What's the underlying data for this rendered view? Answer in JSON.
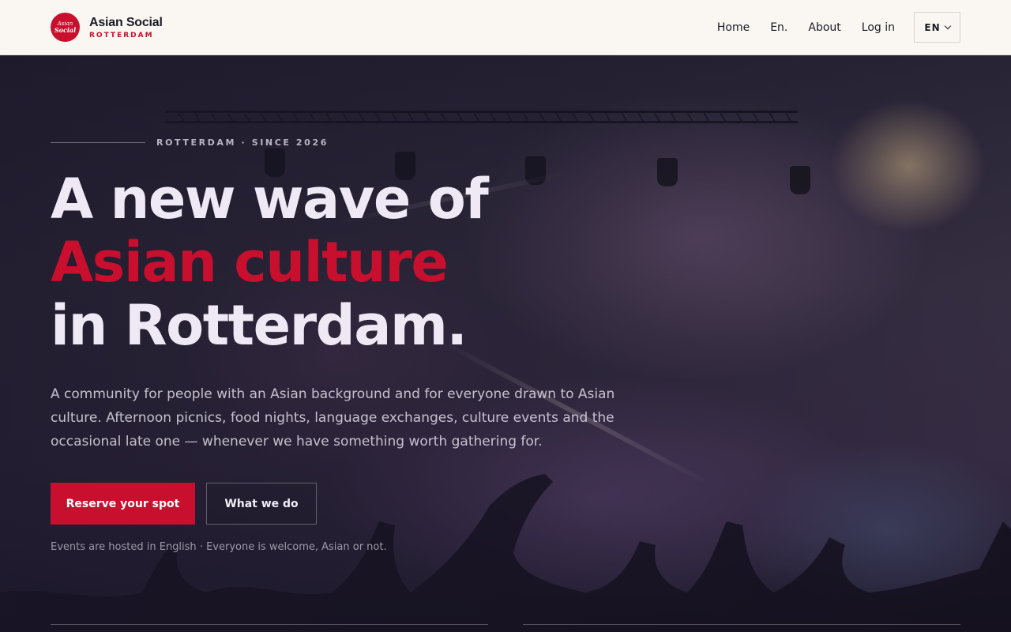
{
  "header": {
    "brand": {
      "logo_top": "Asian",
      "logo_bottom": "Social",
      "name": "Asian Social",
      "city": "ROTTERDAM"
    },
    "nav": [
      {
        "label": "Home"
      },
      {
        "label": "En."
      },
      {
        "label": "About"
      },
      {
        "label": "Log in"
      }
    ],
    "language": {
      "selected": "EN"
    }
  },
  "hero": {
    "eyebrow": "ROTTERDAM · SINCE 2026",
    "title_line1": "A new wave of",
    "title_line2": "Asian culture",
    "title_line3": "in Rotterdam.",
    "lead": "A community for people with an Asian background and for everyone drawn to Asian culture. Afternoon picnics, food nights, language exchanges, culture events and the occasional late one — whenever we have something worth gathering for.",
    "primary_cta": "Reserve your spot",
    "secondary_cta": "What we do",
    "note": "Events are hosted in English · Everyone is welcome, Asian or not."
  },
  "colors": {
    "accent": "#c8102e",
    "header_bg": "#faf7f2",
    "hero_text": "#efe9f5"
  }
}
